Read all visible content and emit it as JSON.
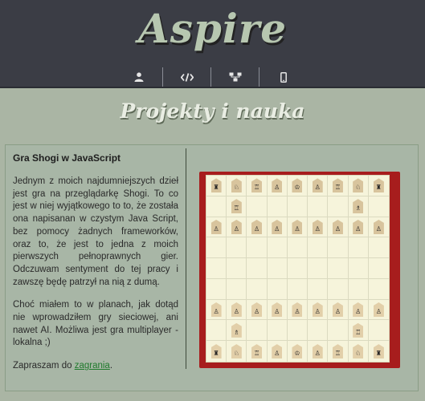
{
  "header": {
    "title": "Aspire",
    "nav": [
      {
        "icon": "user-icon"
      },
      {
        "icon": "code-icon"
      },
      {
        "icon": "sitemap-icon"
      },
      {
        "icon": "mobile-icon"
      }
    ]
  },
  "page": {
    "subtitle": "Projekty i nauka"
  },
  "project": {
    "title": "Gra Shogi w JavaScript",
    "paragraph1": "Jednym z moich najdumniejszych dzieł jest gra na przeglądarkę Shogi. To co jest w niej wyjątkowego to to, że została ona napisanan w czystym Java Script, bez pomocy żadnych frameworków, oraz to, że jest to jedna z moich pierwszych pełnoprawnych gier. Odczuwam sentyment do tej pracy i zawszę będę patrzył na nią z dumą.",
    "paragraph2": "Choć miałem to w planach, jak dotąd nie wprowadziłem gry sieciowej, ani nawet AI. Możliwa jest gra multiplayer - lokalna ;)",
    "paragraph3_prefix": "Zapraszam do ",
    "link_label": "zagrania",
    "paragraph3_suffix": "."
  },
  "board": {
    "colors": {
      "frame": "#a71d1d",
      "square": "#f6f4db",
      "piece": "#e2cfa9"
    },
    "rows": [
      [
        "♜",
        "♘",
        "♖",
        "♙",
        "♔",
        "♙",
        "♖",
        "♘",
        "♜"
      ],
      [
        "",
        "♖",
        "",
        "",
        "",
        "",
        "",
        "♗",
        ""
      ],
      [
        "♙",
        "♙",
        "♙",
        "♙",
        "♙",
        "♙",
        "♙",
        "♙",
        "♙"
      ],
      [
        "",
        "",
        "",
        "",
        "",
        "",
        "",
        "",
        ""
      ],
      [
        "",
        "",
        "",
        "",
        "",
        "",
        "",
        "",
        ""
      ],
      [
        "",
        "",
        "",
        "",
        "",
        "",
        "",
        "",
        ""
      ],
      [
        "♙",
        "♙",
        "♙",
        "♙",
        "♙",
        "♙",
        "♙",
        "♙",
        "♙"
      ],
      [
        "",
        "♗",
        "",
        "",
        "",
        "",
        "",
        "♖",
        ""
      ],
      [
        "♜",
        "♘",
        "♖",
        "♙",
        "♔",
        "♙",
        "♖",
        "♘",
        "♜"
      ]
    ]
  }
}
